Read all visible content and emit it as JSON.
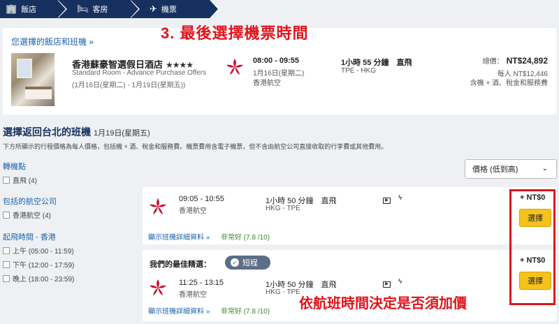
{
  "nav": {
    "steps": [
      {
        "label": "飯店",
        "icon": "building-icon"
      },
      {
        "label": "客房",
        "icon": "bed-icon"
      },
      {
        "label": "機票",
        "icon": "airplane-icon"
      }
    ]
  },
  "annotations": {
    "top": "3. 最後選擇機票時間",
    "bottom": "依航班時間決定是否須加價"
  },
  "summary": {
    "title": "您選擇的飯店和班機",
    "chevron": "»",
    "hotel": {
      "name": "香港蘇豪智選假日酒店",
      "stars": "★★★★",
      "room": "Standard Room - Advance Purchase Offers",
      "dates": "(1月16日(星期二) - 1月19日(星期五))"
    },
    "flight": {
      "time": "08:00 - 09:55",
      "date": "1月16日(星期二)",
      "airline": "香港航空",
      "duration": "1小時 55 分鐘　直飛",
      "route": "TPE - HKG"
    },
    "price": {
      "total_label": "總價：",
      "total": "NT$24,892",
      "per_person": "每人 NT$12,446",
      "includes": "含機 + 酒、稅金和服務費"
    }
  },
  "section": {
    "title": "選擇返回台北的班機",
    "date": "1月19日(星期五)",
    "note": "下方所顯示的行程價格為每人價格，包括機 + 酒、稅金和服務費。機票費用含電子機票，但不含由航空公司直接收取的行李費或其他費用。"
  },
  "filters": {
    "stops": {
      "title": "轉機點",
      "options": [
        "直飛 (4)"
      ]
    },
    "airlines": {
      "title": "包括的航空公司",
      "options": [
        "香港航空 (4)"
      ]
    },
    "departure": {
      "title": "起飛時間 - 香港",
      "options": [
        "上午 (05:00 - 11:59)",
        "下午 (12:00 - 17:59)",
        "晚上 (18:00 - 23:59)"
      ]
    }
  },
  "sort": {
    "selected": "價格 (低到高)",
    "chevron": "⌄"
  },
  "flights": [
    {
      "time": "09:05 - 10:55",
      "airline": "香港航空",
      "duration": "1小時 50 分鐘　直飛",
      "route": "HKG - TPE",
      "details_link": "顯示班機詳細資料 »",
      "score": "非常好 (7.8 /10)",
      "price": "+ NT$0",
      "select_label": "選擇"
    },
    {
      "best_label": "我們的最佳精選：",
      "badge": "短程",
      "time": "11:25 - 13:15",
      "airline": "香港航空",
      "duration": "1小時 50 分鐘　直飛",
      "route": "HKG - TPE",
      "details_link": "顯示班機詳細資料 »",
      "score": "非常好 (7.8 /10)",
      "price": "+ NT$0",
      "select_label": "選擇"
    }
  ],
  "colors": {
    "navy": "#17315f",
    "link": "#1b63b0",
    "accent_red": "#e0141b",
    "button_yellow": "#f6c11b"
  }
}
